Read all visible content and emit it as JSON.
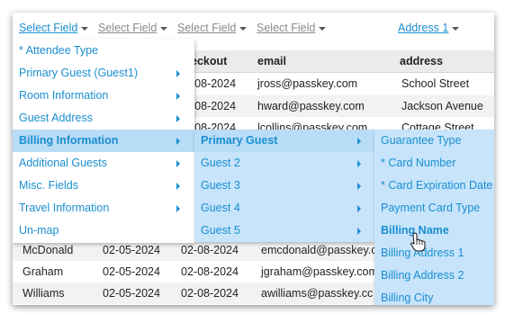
{
  "field_selectors": [
    {
      "label": "Select Field",
      "active": true
    },
    {
      "label": "Select Field",
      "active": false
    },
    {
      "label": "Select Field",
      "active": false
    },
    {
      "label": "Select Field",
      "active": false
    },
    {
      "label": "Address 1",
      "active": true
    }
  ],
  "table": {
    "headers": [
      "eckout",
      "email",
      "address"
    ],
    "rows": [
      {
        "checkin": "",
        "checkout": "-08-2024",
        "email": "jross@passkey.com",
        "address": "School Street"
      },
      {
        "checkin": "",
        "checkout": "-08-2024",
        "email": "hward@passkey.com",
        "address": "Jackson Avenue"
      },
      {
        "checkin": "",
        "checkout": "-08-2024",
        "email": "lcollins@passkey.com",
        "address": "Cottage Street"
      },
      {
        "last": "McDonald",
        "checkin": "02-05-2024",
        "checkout": "02-08-2024",
        "email": "emcdonald@passkey.cc"
      },
      {
        "last": "Graham",
        "checkin": "02-05-2024",
        "checkout": "02-08-2024",
        "email": "jgraham@passkey.com"
      },
      {
        "last": "Williams",
        "checkin": "02-05-2024",
        "checkout": "02-08-2024",
        "email": "awilliams@passkey.cc"
      }
    ]
  },
  "menu_level1": [
    {
      "label": "* Attendee Type",
      "submenu": false
    },
    {
      "label": "Primary Guest (Guest1)",
      "submenu": true
    },
    {
      "label": "Room Information",
      "submenu": true
    },
    {
      "label": "Guest Address",
      "submenu": true
    },
    {
      "label": "Billing Information",
      "submenu": true,
      "active": true
    },
    {
      "label": "Additional Guests",
      "submenu": true
    },
    {
      "label": "Misc. Fields",
      "submenu": true
    },
    {
      "label": "Travel Information",
      "submenu": true
    },
    {
      "label": "Un-map",
      "submenu": false
    }
  ],
  "menu_level2": [
    {
      "label": "Primary Guest",
      "submenu": true,
      "active": true
    },
    {
      "label": "Guest 2",
      "submenu": true
    },
    {
      "label": "Guest 3",
      "submenu": true
    },
    {
      "label": "Guest 4",
      "submenu": true
    },
    {
      "label": "Guest 5",
      "submenu": true
    }
  ],
  "menu_level3": [
    {
      "label": "Guarantee Type"
    },
    {
      "label": "* Card Number"
    },
    {
      "label": "* Card Expiration Date"
    },
    {
      "label": "Payment Card Type"
    },
    {
      "label": "Billing Name",
      "hover": true
    },
    {
      "label": "Billing Address 1"
    },
    {
      "label": "Billing Address 2"
    },
    {
      "label": "Billing City"
    }
  ],
  "colors": {
    "link": "#1a8fd0",
    "submenu_bg": "#c7e4fb",
    "active_bg": "#b9dcf7",
    "header_bg": "#ebebeb"
  },
  "icons": [
    "chevron-down-icon",
    "chevron-right-icon",
    "hand-pointer-icon"
  ]
}
